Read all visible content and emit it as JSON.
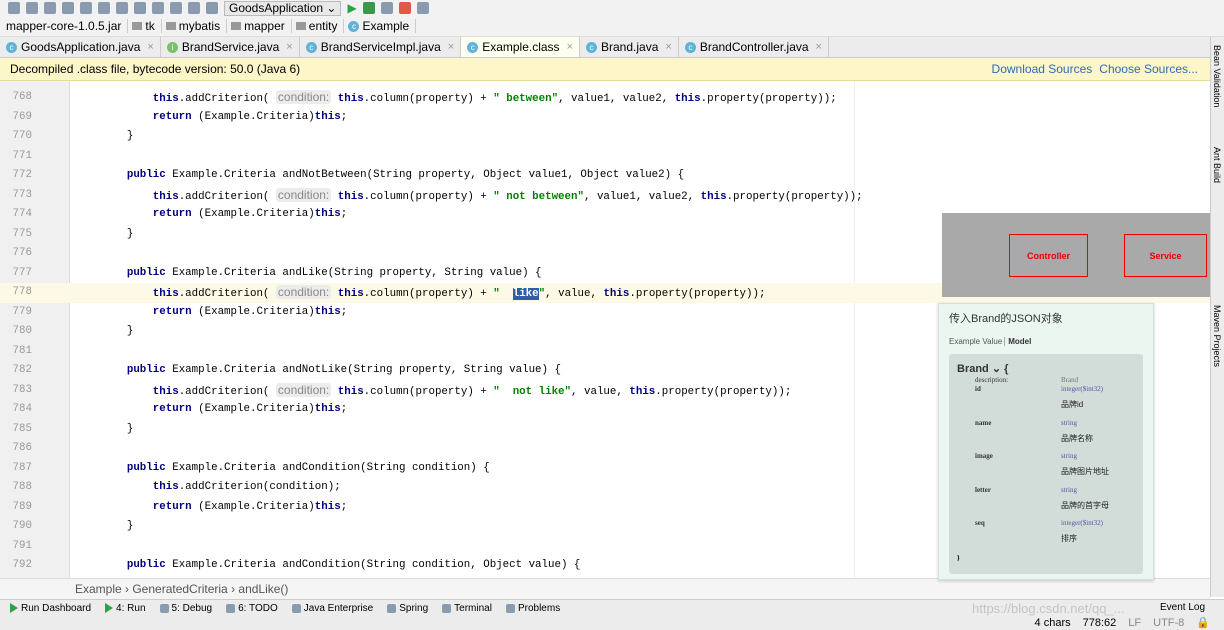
{
  "toolbar": {
    "run_config": "GoodsApplication"
  },
  "breadcrumb": [
    "mapper-core-1.0.5.jar",
    "tk",
    "mybatis",
    "mapper",
    "entity",
    "Example"
  ],
  "tabs": [
    {
      "label": "GoodsApplication.java",
      "icon": "c"
    },
    {
      "label": "BrandService.java",
      "icon": "i"
    },
    {
      "label": "BrandServiceImpl.java",
      "icon": "c"
    },
    {
      "label": "Example.class",
      "icon": "c",
      "active": true
    },
    {
      "label": "Brand.java",
      "icon": "c"
    },
    {
      "label": "BrandController.java",
      "icon": "c"
    }
  ],
  "banner": {
    "text": "Decompiled .class file, bytecode version: 50.0 (Java 6)",
    "download": "Download Sources",
    "choose": "Choose Sources..."
  },
  "current_line": 778,
  "code": [
    {
      "n": "768",
      "t": [
        [
          "p",
          "            "
        ],
        [
          "k",
          "this"
        ],
        [
          "p",
          ".addCriterion( "
        ],
        [
          "h",
          "condition:"
        ],
        [
          "p",
          " "
        ],
        [
          "k",
          "this"
        ],
        [
          "p",
          ".column(property) + "
        ],
        [
          "s",
          "\" between\""
        ],
        [
          "p",
          ", value1, value2, "
        ],
        [
          "k",
          "this"
        ],
        [
          "p",
          ".property(property));"
        ]
      ]
    },
    {
      "n": "769",
      "t": [
        [
          "p",
          "            "
        ],
        [
          "k",
          "return"
        ],
        [
          "p",
          " (Example.Criteria)"
        ],
        [
          "k",
          "this"
        ],
        [
          "p",
          ";"
        ]
      ]
    },
    {
      "n": "770",
      "t": [
        [
          "p",
          "        }"
        ]
      ]
    },
    {
      "n": "771",
      "t": []
    },
    {
      "n": "772",
      "t": [
        [
          "p",
          "        "
        ],
        [
          "k",
          "public"
        ],
        [
          "p",
          " Example.Criteria andNotBetween(String property, Object value1, Object value2) {"
        ]
      ]
    },
    {
      "n": "773",
      "t": [
        [
          "p",
          "            "
        ],
        [
          "k",
          "this"
        ],
        [
          "p",
          ".addCriterion( "
        ],
        [
          "h",
          "condition:"
        ],
        [
          "p",
          " "
        ],
        [
          "k",
          "this"
        ],
        [
          "p",
          ".column(property) + "
        ],
        [
          "s",
          "\" not between\""
        ],
        [
          "p",
          ", value1, value2, "
        ],
        [
          "k",
          "this"
        ],
        [
          "p",
          ".property(property));"
        ]
      ]
    },
    {
      "n": "774",
      "t": [
        [
          "p",
          "            "
        ],
        [
          "k",
          "return"
        ],
        [
          "p",
          " (Example.Criteria)"
        ],
        [
          "k",
          "this"
        ],
        [
          "p",
          ";"
        ]
      ]
    },
    {
      "n": "775",
      "t": [
        [
          "p",
          "        }"
        ]
      ]
    },
    {
      "n": "776",
      "t": []
    },
    {
      "n": "777",
      "t": [
        [
          "p",
          "        "
        ],
        [
          "k",
          "public"
        ],
        [
          "p",
          " Example.Criteria andLike(String property, String value) {"
        ]
      ]
    },
    {
      "n": "778",
      "t": [
        [
          "p",
          "            "
        ],
        [
          "k",
          "this"
        ],
        [
          "p",
          ".addCriterion( "
        ],
        [
          "h",
          "condition:"
        ],
        [
          "p",
          " "
        ],
        [
          "k",
          "this"
        ],
        [
          "p",
          ".column(property) + "
        ],
        [
          "s",
          "\"  "
        ],
        [
          "x",
          "like"
        ],
        [
          "s",
          "\""
        ],
        [
          "p",
          ", value, "
        ],
        [
          "k",
          "this"
        ],
        [
          "p",
          ".property(property));"
        ]
      ]
    },
    {
      "n": "779",
      "t": [
        [
          "p",
          "            "
        ],
        [
          "k",
          "return"
        ],
        [
          "p",
          " (Example.Criteria)"
        ],
        [
          "k",
          "this"
        ],
        [
          "p",
          ";"
        ]
      ]
    },
    {
      "n": "780",
      "t": [
        [
          "p",
          "        }"
        ]
      ]
    },
    {
      "n": "781",
      "t": []
    },
    {
      "n": "782",
      "t": [
        [
          "p",
          "        "
        ],
        [
          "k",
          "public"
        ],
        [
          "p",
          " Example.Criteria andNotLike(String property, String value) {"
        ]
      ]
    },
    {
      "n": "783",
      "t": [
        [
          "p",
          "            "
        ],
        [
          "k",
          "this"
        ],
        [
          "p",
          ".addCriterion( "
        ],
        [
          "h",
          "condition:"
        ],
        [
          "p",
          " "
        ],
        [
          "k",
          "this"
        ],
        [
          "p",
          ".column(property) + "
        ],
        [
          "s",
          "\"  not like\""
        ],
        [
          "p",
          ", value, "
        ],
        [
          "k",
          "this"
        ],
        [
          "p",
          ".property(property));"
        ]
      ]
    },
    {
      "n": "784",
      "t": [
        [
          "p",
          "            "
        ],
        [
          "k",
          "return"
        ],
        [
          "p",
          " (Example.Criteria)"
        ],
        [
          "k",
          "this"
        ],
        [
          "p",
          ";"
        ]
      ]
    },
    {
      "n": "785",
      "t": [
        [
          "p",
          "        }"
        ]
      ]
    },
    {
      "n": "786",
      "t": []
    },
    {
      "n": "787",
      "t": [
        [
          "p",
          "        "
        ],
        [
          "k",
          "public"
        ],
        [
          "p",
          " Example.Criteria andCondition(String condition) {"
        ]
      ]
    },
    {
      "n": "788",
      "t": [
        [
          "p",
          "            "
        ],
        [
          "k",
          "this"
        ],
        [
          "p",
          ".addCriterion(condition);"
        ]
      ]
    },
    {
      "n": "789",
      "t": [
        [
          "p",
          "            "
        ],
        [
          "k",
          "return"
        ],
        [
          "p",
          " (Example.Criteria)"
        ],
        [
          "k",
          "this"
        ],
        [
          "p",
          ";"
        ]
      ]
    },
    {
      "n": "790",
      "t": [
        [
          "p",
          "        }"
        ]
      ]
    },
    {
      "n": "791",
      "t": []
    },
    {
      "n": "792",
      "t": [
        [
          "p",
          "        "
        ],
        [
          "k",
          "public"
        ],
        [
          "p",
          " Example.Criteria andCondition(String condition, Object value) {"
        ]
      ]
    }
  ],
  "right_panels": [
    "Bean Validation",
    "Ant Build",
    "Maven Projects"
  ],
  "code_breadcrumb": "Example › GeneratedCriteria › andLike()",
  "tool_windows": [
    "Run Dashboard",
    "4: Run",
    "5: Debug",
    "6: TODO",
    "Java Enterprise",
    "Spring",
    "Terminal",
    "Problems"
  ],
  "event_log": "Event Log",
  "watermark": "https://blog.csdn.net/qq_...",
  "status": {
    "chars": "4 chars",
    "pos": "778:62",
    "sep": "LF",
    "enc": "UTF-8"
  },
  "overlay": {
    "left": "Controller",
    "right": "Service"
  },
  "swagger": {
    "title": "传入Brand的JSON对象",
    "tab1": "Example Value",
    "tab2": "Model",
    "model": "Brand",
    "open": "{",
    "close": "}",
    "desc_key": "description:",
    "desc_val": "Brand",
    "props": [
      {
        "name": "id",
        "type": "integer($int32)",
        "desc": "品牌id"
      },
      {
        "name": "name",
        "type": "string",
        "desc": "品牌名称"
      },
      {
        "name": "image",
        "type": "string",
        "desc": "品牌图片地址"
      },
      {
        "name": "letter",
        "type": "string",
        "desc": "品牌的首字母"
      },
      {
        "name": "seq",
        "type": "integer($int32)",
        "desc": "排序"
      }
    ]
  }
}
